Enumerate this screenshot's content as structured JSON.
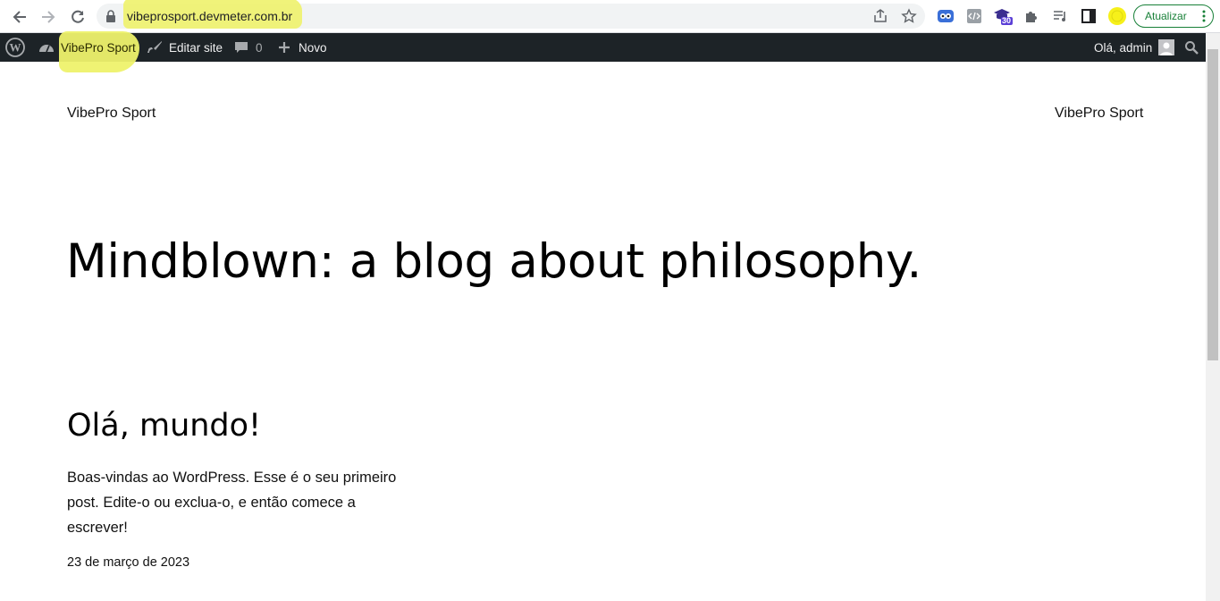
{
  "browser": {
    "url": "vibeprosport.devmeter.com.br",
    "update_label": "Atualizar",
    "ext_badge": "30"
  },
  "adminbar": {
    "site_name": "VibePro Sport",
    "edit_site": "Editar site",
    "comments_count": "0",
    "new_label": "Novo",
    "greeting": "Olá, admin"
  },
  "site": {
    "title_left": "VibePro Sport",
    "title_right": "VibePro Sport",
    "tagline": "Mindblown: a blog about philosophy."
  },
  "post": {
    "title": "Olá, mundo!",
    "excerpt": "Boas-vindas ao WordPress. Esse é o seu primeiro post. Edite-o ou exclua-o, e então comece a escrever!",
    "date": "23 de março de 2023"
  },
  "colors": {
    "adminbar_bg": "#1d2327",
    "highlight": "#eef26b",
    "update_green": "#188038"
  }
}
